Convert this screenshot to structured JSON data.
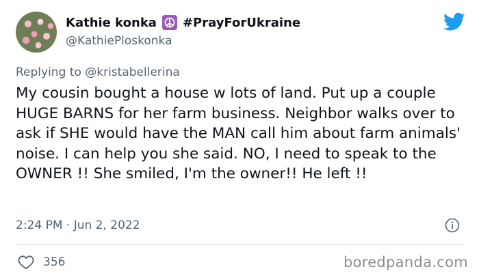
{
  "author": {
    "display_name": "Kathie konka",
    "hashtag": "#PrayForUkraine",
    "handle": "@KathiePloskonka"
  },
  "reply": {
    "prefix": "Replying to",
    "mention": "@kristabellerina"
  },
  "tweet": {
    "text": "My cousin bought a house w lots of land. Put up a couple HUGE BARNS for her farm business. Neighbor walks over to ask if SHE would have the MAN call him about farm animals' noise. I can help you she said. NO, I need to speak to the OWNER !! She smiled, I'm the owner!! He left !!",
    "timestamp": "2:24 PM · Jun 2, 2022",
    "likes": "356"
  },
  "watermark": "boredpanda.com",
  "icons": {
    "brand": "twitter-bird-icon",
    "emoji": "peace-symbol-icon",
    "info": "info-icon",
    "like": "heart-icon"
  },
  "colors": {
    "twitter_blue": "#1d9bf0",
    "text_primary": "#0f1419",
    "text_secondary": "#536471",
    "peace_purple": "#9b59b6"
  }
}
